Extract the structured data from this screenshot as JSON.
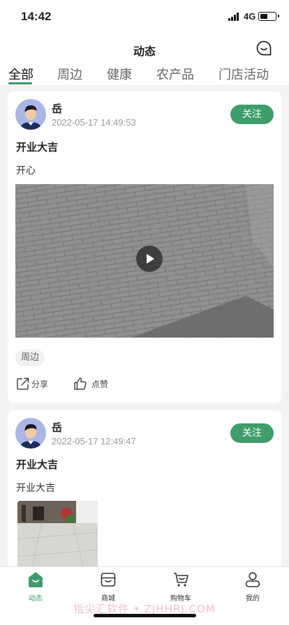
{
  "status_bar": {
    "time": "14:42",
    "network": "4G",
    "battery_level": 0.4
  },
  "header": {
    "title": "动态",
    "message_icon": "chat-bubble-icon"
  },
  "tabs": [
    {
      "label": "全部",
      "active": true
    },
    {
      "label": "周边",
      "active": false
    },
    {
      "label": "健康",
      "active": false
    },
    {
      "label": "农产品",
      "active": false
    },
    {
      "label": "门店活动",
      "active": false
    }
  ],
  "posts": [
    {
      "user": "岳",
      "time": "2022-05-17 14:49:53",
      "follow_label": "关注",
      "title": "开业大吉",
      "body": "开心",
      "media": "video",
      "tag": "周边",
      "share_label": "分享",
      "like_label": "点赞"
    },
    {
      "user": "岳",
      "time": "2022-05-17 12:49:47",
      "follow_label": "关注",
      "title": "开业大吉",
      "body": "开业大吉",
      "media": "image"
    }
  ],
  "bottom_nav": [
    {
      "label": "动态",
      "icon": "feed-icon",
      "active": true
    },
    {
      "label": "商城",
      "icon": "store-icon",
      "active": false
    },
    {
      "label": "购物车",
      "icon": "cart-icon",
      "active": false
    },
    {
      "label": "我的",
      "icon": "profile-icon",
      "active": false
    }
  ],
  "watermark": "指尖汇软件 • ZJHHRJ.COM",
  "colors": {
    "accent": "#3f9d6c",
    "tab_underline": "#3a9a6a"
  }
}
